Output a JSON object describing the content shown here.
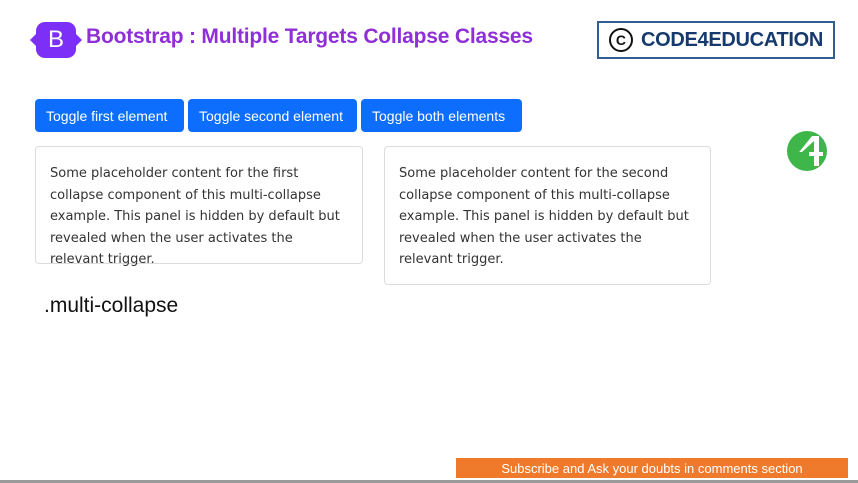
{
  "header": {
    "logo_letter": "B",
    "title": "Bootstrap : Multiple Targets Collapse Classes",
    "brand": {
      "symbol": "C",
      "text": "CODE4EDUCATION"
    }
  },
  "buttons": [
    {
      "label": "Toggle first element"
    },
    {
      "label": "Toggle second element"
    },
    {
      "label": "Toggle both elements"
    }
  ],
  "cards": [
    {
      "text": "Some placeholder content for the first collapse component of this multi-collapse example. This panel is hidden by default but revealed when the user activates the relevant trigger."
    },
    {
      "text": "Some placeholder content for the second collapse component of this multi-collapse example. This panel is hidden by default but revealed when the user activates the relevant trigger."
    }
  ],
  "class_label": ".multi-collapse",
  "footer": {
    "subscribe": "Subscribe and Ask your doubts in comments section"
  },
  "colors": {
    "primary": "#0d6efd",
    "title": "#8f2fd8",
    "bootstrap": "#7b2ff7",
    "subscribe": "#f07a2c",
    "logo_green": "#3fb64a"
  },
  "icons": [
    "bootstrap-logo-icon",
    "copyright-icon",
    "code4education-logo-icon"
  ]
}
